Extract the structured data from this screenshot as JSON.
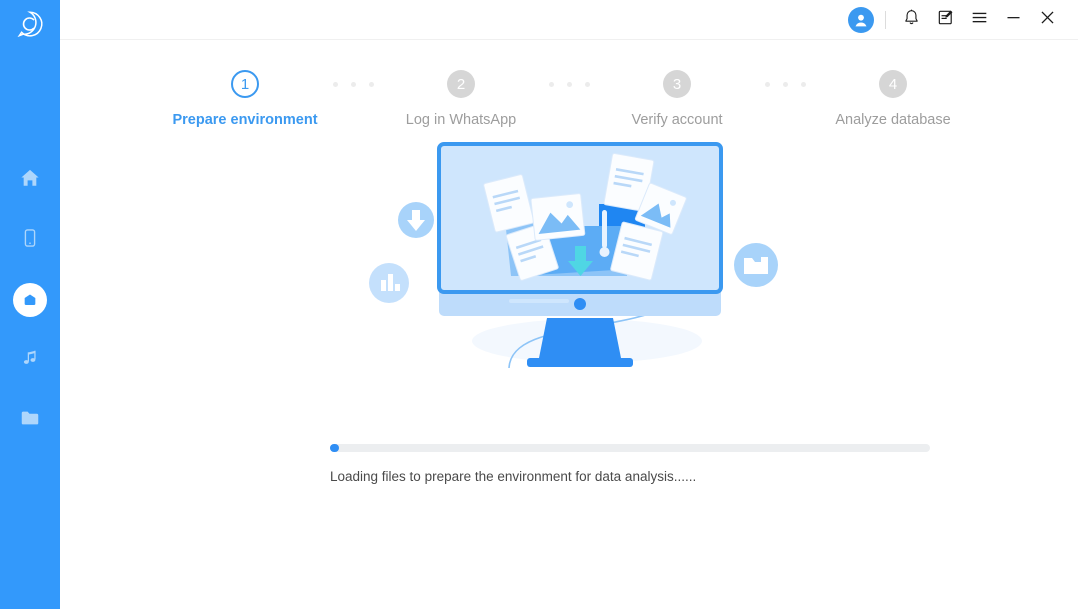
{
  "app": {
    "logo_icon": "chat-bubble-c-logo",
    "accent_color": "#3399fb",
    "sidebar_color": "#3399fb"
  },
  "sidebar": {
    "items": [
      {
        "icon": "home-icon",
        "name": "home",
        "active": false
      },
      {
        "icon": "mobile-phone-icon",
        "name": "device",
        "active": false
      },
      {
        "icon": "droplet-hexagon-icon",
        "name": "whatsapp-transfer",
        "active": true
      },
      {
        "icon": "music-note-icon",
        "name": "music",
        "active": false
      },
      {
        "icon": "folder-icon",
        "name": "files",
        "active": false
      }
    ]
  },
  "titlebar": {
    "buttons": [
      {
        "icon": "avatar-icon",
        "name": "account-avatar"
      },
      {
        "icon": "bell-icon",
        "name": "notifications"
      },
      {
        "icon": "feedback-edit-icon",
        "name": "feedback"
      },
      {
        "icon": "hamburger-menu-icon",
        "name": "menu"
      },
      {
        "icon": "minimize-icon",
        "name": "minimize"
      },
      {
        "icon": "close-icon",
        "name": "close"
      }
    ]
  },
  "stepper": {
    "steps": [
      {
        "number": "1",
        "label": "Prepare environment",
        "state": "active"
      },
      {
        "number": "2",
        "label": "Log in WhatsApp",
        "state": "inactive"
      },
      {
        "number": "3",
        "label": "Verify account",
        "state": "inactive"
      },
      {
        "number": "4",
        "label": "Analyze database",
        "state": "inactive"
      }
    ]
  },
  "illustration": {
    "name": "monitor-file-transfer-illustration",
    "badges": [
      {
        "icon": "download-arrow-icon",
        "name": "download-badge"
      },
      {
        "icon": "bar-chart-icon",
        "name": "chart-badge"
      },
      {
        "icon": "video-folder-icon",
        "name": "video-badge"
      }
    ]
  },
  "progress": {
    "percent": 1.5,
    "status_text": "Loading files to prepare the environment for data analysis......",
    "fill_color": "#2f8ef4",
    "track_color": "#eceef0"
  }
}
